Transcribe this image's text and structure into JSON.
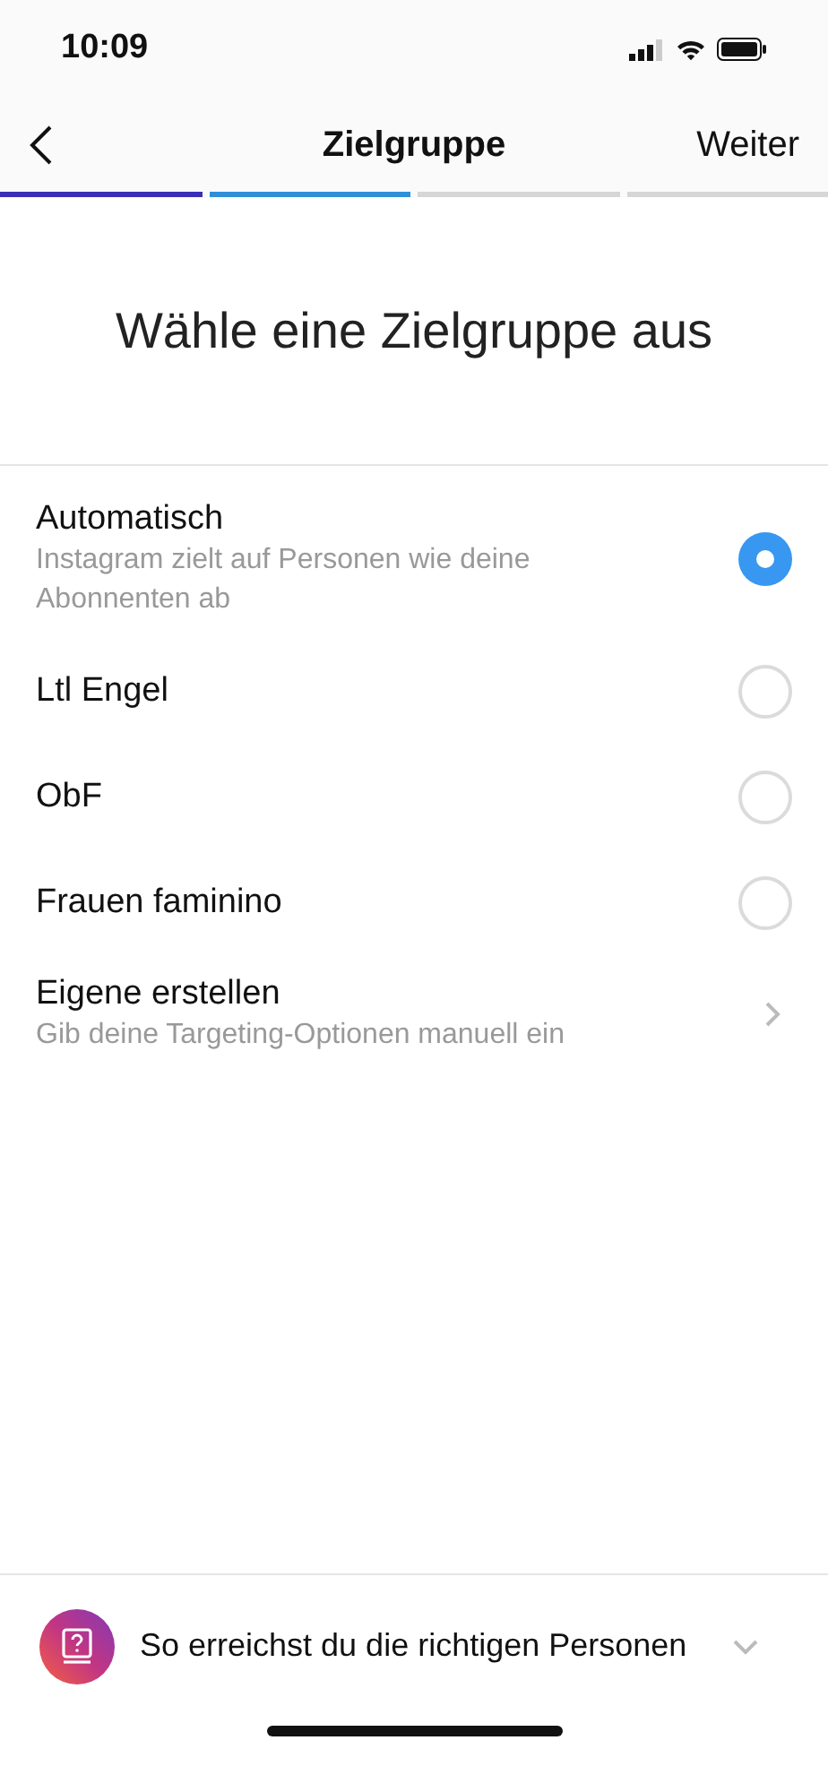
{
  "status_bar": {
    "time": "10:09"
  },
  "nav": {
    "title": "Zielgruppe",
    "action": "Weiter"
  },
  "progress": [
    {
      "color": "#3b2fb8"
    },
    {
      "color": "#2f8fd8"
    },
    {
      "color": "#d6d6d6"
    },
    {
      "color": "#d6d6d6"
    }
  ],
  "heading": "Wähle eine Zielgruppe aus",
  "options": [
    {
      "kind": "radio",
      "label": "Automatisch",
      "description": "Instagram zielt auf Personen wie deine Abonnenten ab",
      "selected": true
    },
    {
      "kind": "radio",
      "label": "Ltl Engel",
      "selected": false
    },
    {
      "kind": "radio",
      "label": "ObF",
      "selected": false
    },
    {
      "kind": "radio",
      "label": "Frauen faminino",
      "selected": false
    },
    {
      "kind": "link",
      "label": "Eigene erstellen",
      "description": "Gib deine Targeting-Optionen manuell ein"
    }
  ],
  "help": {
    "label": "So erreichst du die richtigen Personen",
    "expanded": false
  }
}
